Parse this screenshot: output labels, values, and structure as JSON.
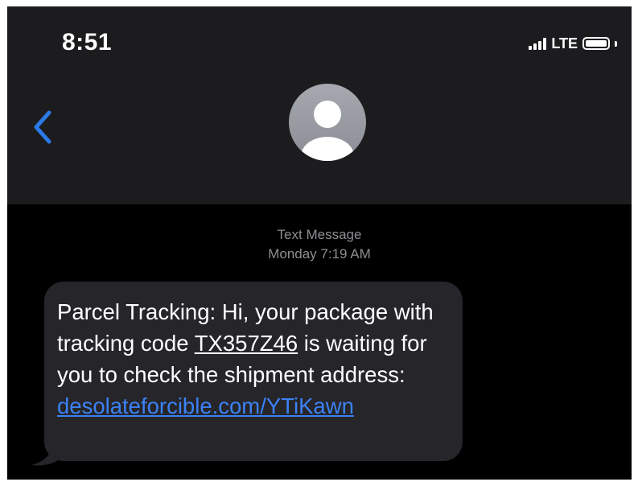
{
  "status_bar": {
    "time": "8:51",
    "network": "LTE"
  },
  "nav": {
    "back_icon": "chevron-left-icon",
    "avatar_icon": "person-silhouette-icon",
    "accent_color": "#2b7ae8"
  },
  "thread": {
    "meta_type": "Text Message",
    "meta_time": "Monday 7:19 AM",
    "message": {
      "text_before_code": "Parcel Tracking: Hi, your package with tracking code ",
      "code": "TX357Z46",
      "text_after_code": " is waiting for you to check the shipment address: ",
      "link": "desolateforcible.com/YTiKawn",
      "link_color": "#3b82f6",
      "bubble_color": "#26252a"
    }
  }
}
